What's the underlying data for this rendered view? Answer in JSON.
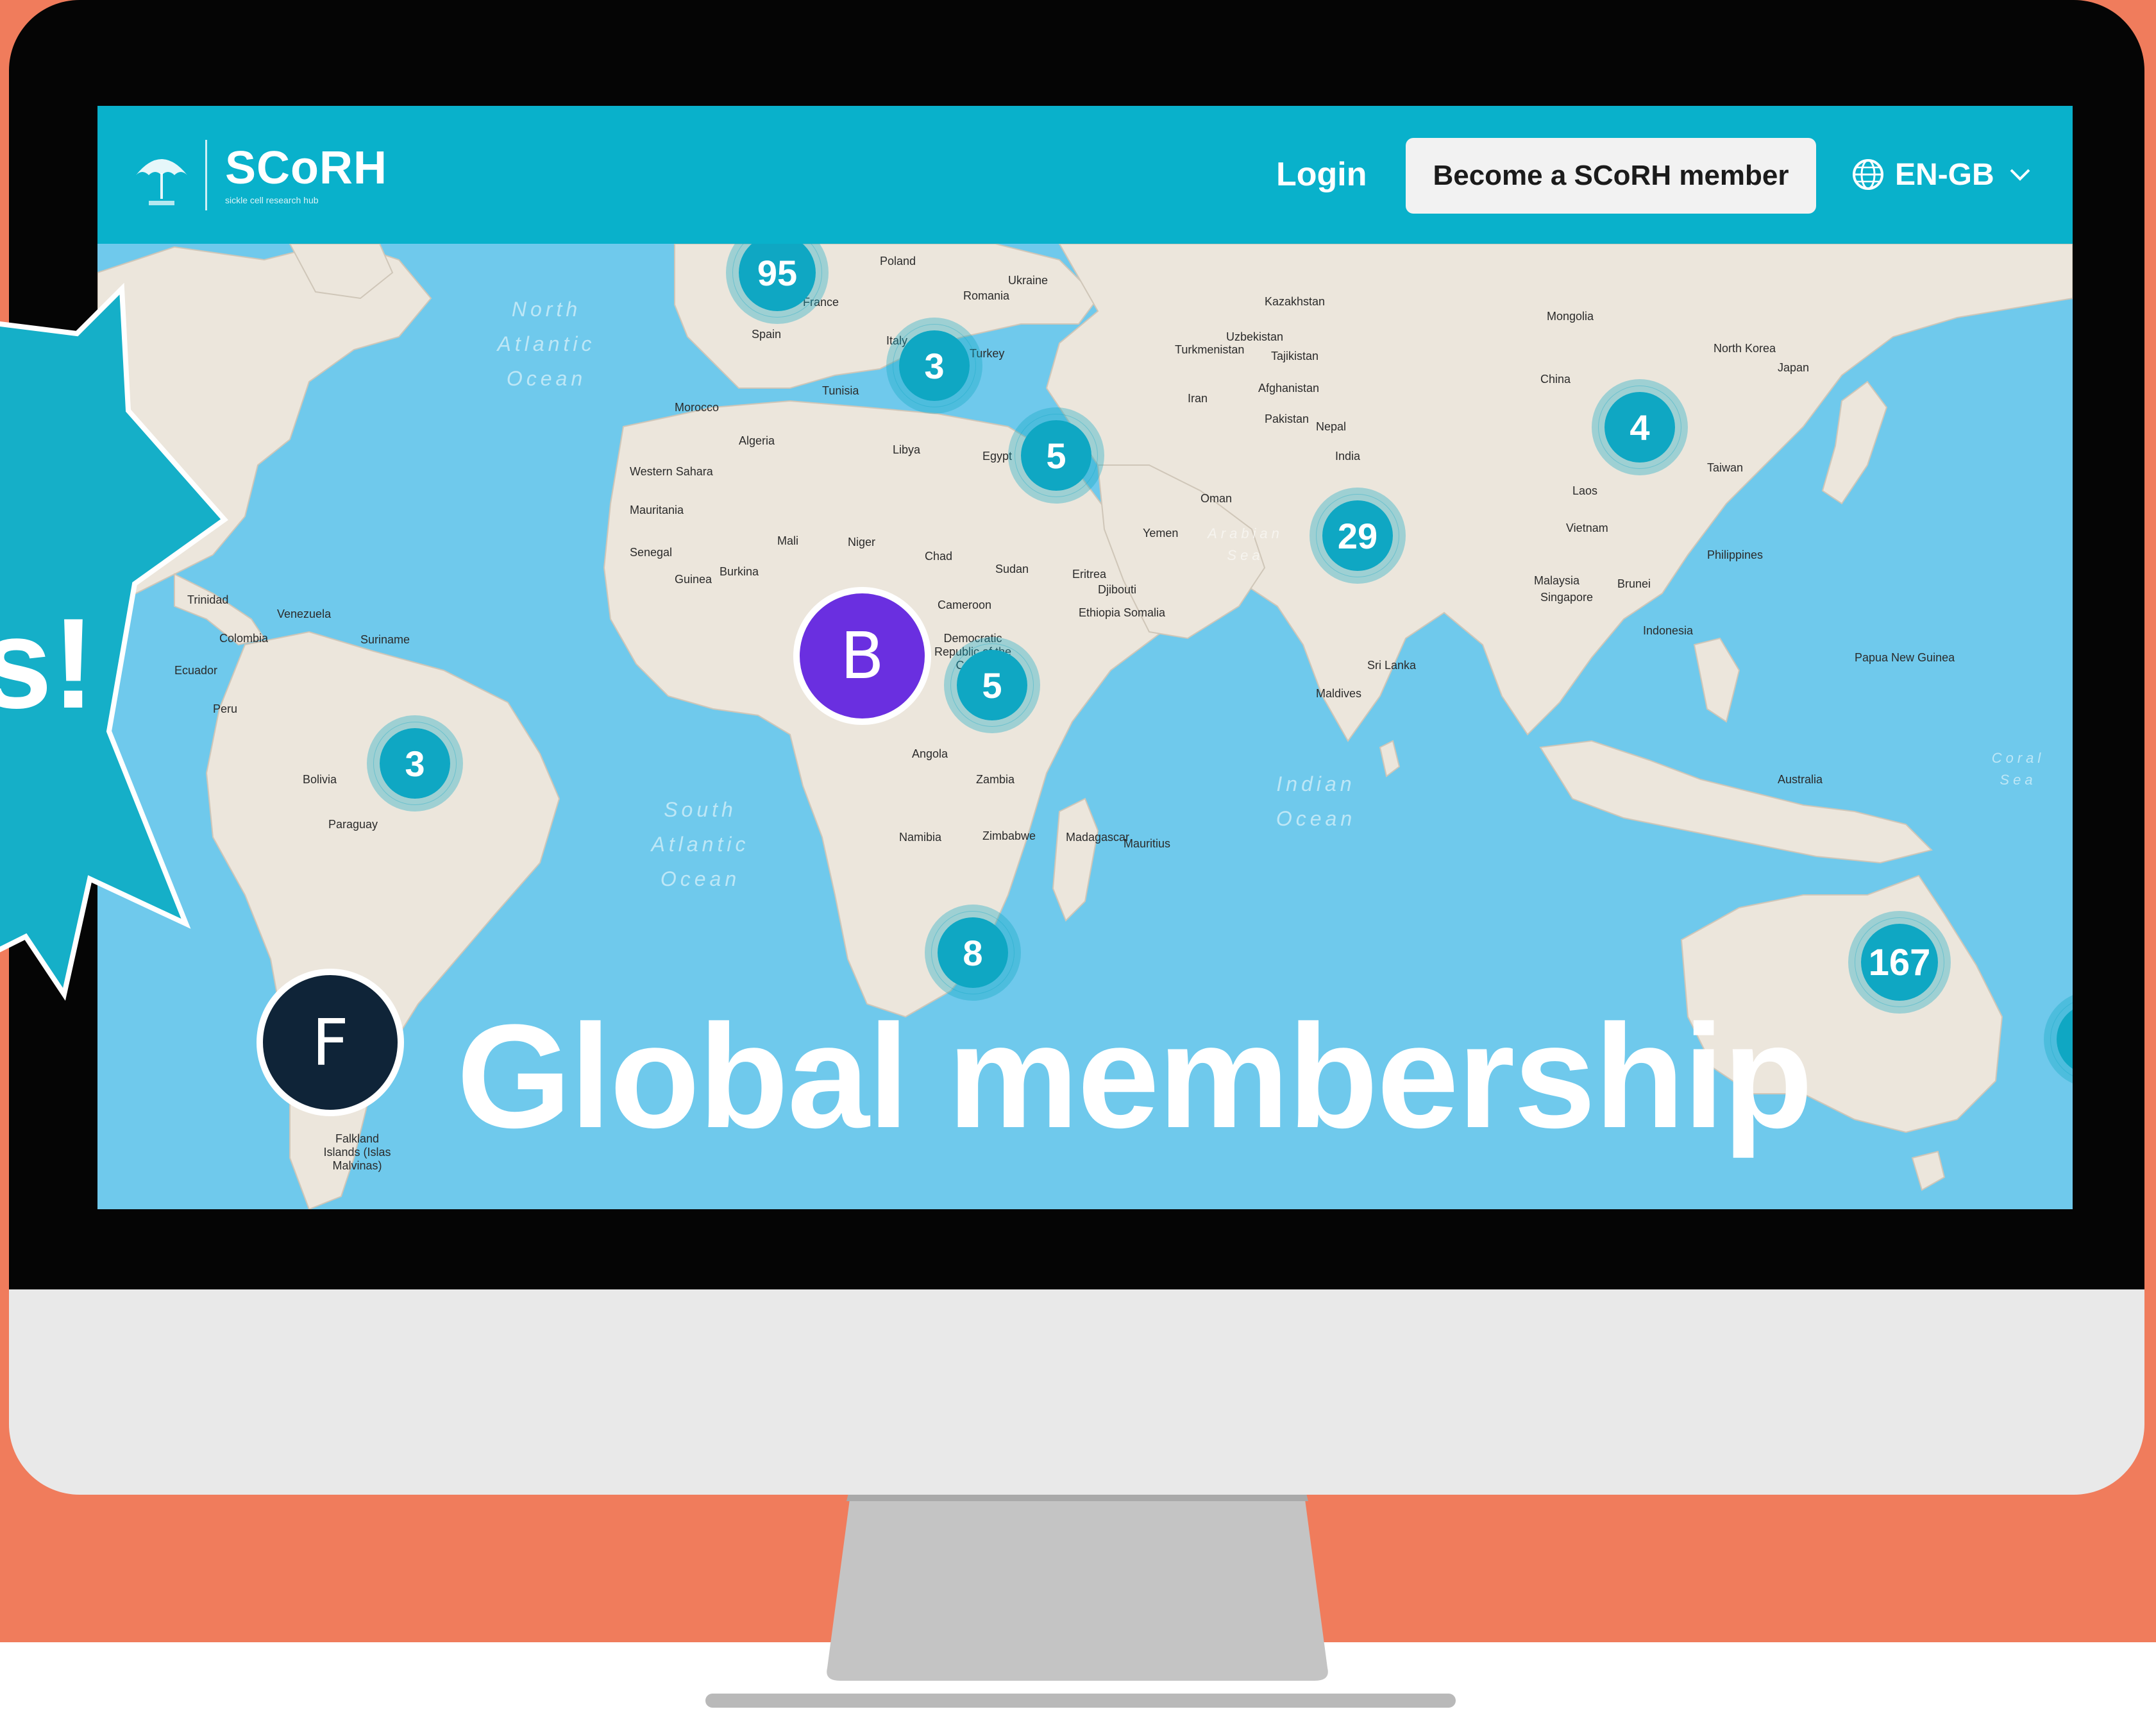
{
  "colors": {
    "background": "#f07c5c",
    "header": "#09b1cb",
    "ocean": "#6fc9ec",
    "land": "#ece6dc",
    "cluster": "#0fa7c3",
    "badge_b": "#6a2fe0",
    "badge_f": "#0f2438",
    "callout": "#15afc8"
  },
  "header": {
    "brand": "SCoRH",
    "brand_tagline": "sickle cell research hub",
    "login": "Login",
    "member_button": "Become a SCoRH member",
    "language": "EN-GB"
  },
  "map": {
    "clusters": [
      "95",
      "3",
      "5",
      "29",
      "4",
      "5",
      "3",
      "8",
      "167"
    ],
    "badges": [
      "B",
      "F"
    ],
    "countries": [
      "Poland",
      "Ukraine",
      "Romania",
      "France",
      "Spain",
      "Italy",
      "Turkey",
      "Kazakhstan",
      "Mongolia",
      "Uzbekistan",
      "Tajikistan",
      "Turkmenistan",
      "Afghanistan",
      "Iran",
      "Pakistan",
      "Nepal",
      "India",
      "China",
      "North Korea",
      "Japan",
      "Taiwan",
      "Laos",
      "Vietnam",
      "Philippines",
      "Malaysia",
      "Singapore",
      "Brunei",
      "Indonesia",
      "Papua New Guinea",
      "Australia",
      "Sri Lanka",
      "Maldives",
      "Oman",
      "Yemen",
      "Morocco",
      "Algeria",
      "Tunisia",
      "Libya",
      "Egypt",
      "Western Sahara",
      "Mauritania",
      "Mali",
      "Niger",
      "Chad",
      "Sudan",
      "Senegal",
      "Guinea",
      "Burkina",
      "Eritrea",
      "Djibouti",
      "Ethiopia",
      "Somalia",
      "Cameroon",
      "Democratic Republic of the Congo",
      "Angola",
      "Zambia",
      "Namibia",
      "Zimbabwe",
      "Madagascar",
      "Mauritius",
      "Venezuela",
      "Colombia",
      "Suriname",
      "Ecuador",
      "Peru",
      "Bolivia",
      "Paraguay",
      "Falkland Islands (Islas Malvinas)",
      "Trinidad"
    ],
    "oceans": [
      "North Atlantic Ocean",
      "South Atlantic Ocean",
      "Indian Ocean",
      "Arabian Sea",
      "Coral Sea"
    ]
  },
  "headline": "Global membership",
  "callout": [
    "s!"
  ]
}
